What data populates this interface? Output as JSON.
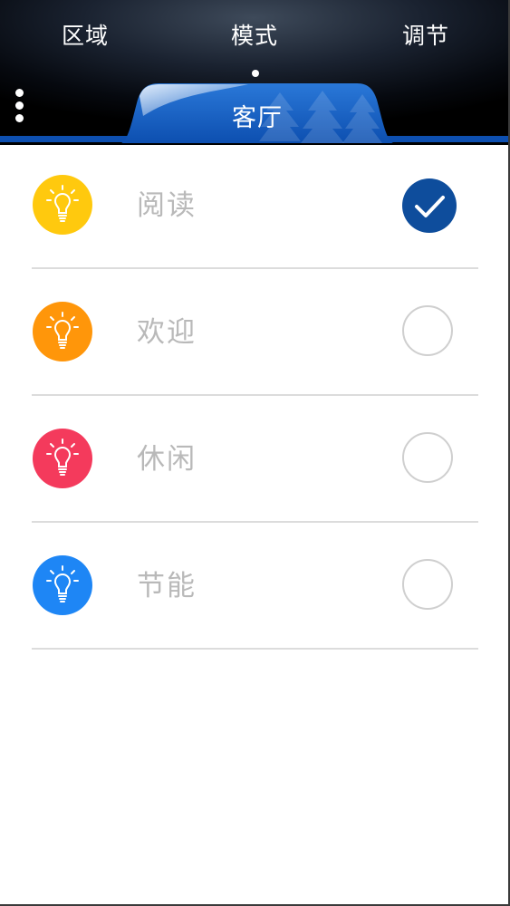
{
  "header": {
    "tabs": [
      {
        "label": "区域"
      },
      {
        "label": "模式"
      },
      {
        "label": "调节"
      }
    ],
    "room": "客厅"
  },
  "modes": [
    {
      "label": "阅读",
      "color": "#ffc90e",
      "selected": true
    },
    {
      "label": "欢迎",
      "color": "#ff960a",
      "selected": false
    },
    {
      "label": "休闲",
      "color": "#f43a5c",
      "selected": false
    },
    {
      "label": "节能",
      "color": "#1e86f5",
      "selected": false
    }
  ],
  "colors": {
    "accent": "#0d4fb0",
    "check_fill": "#0e4d9c",
    "label_gray": "#b9b9b9"
  },
  "icons": {
    "bulb": "lightbulb-icon",
    "check": "checkmark-icon",
    "menu": "more-vertical-icon"
  }
}
